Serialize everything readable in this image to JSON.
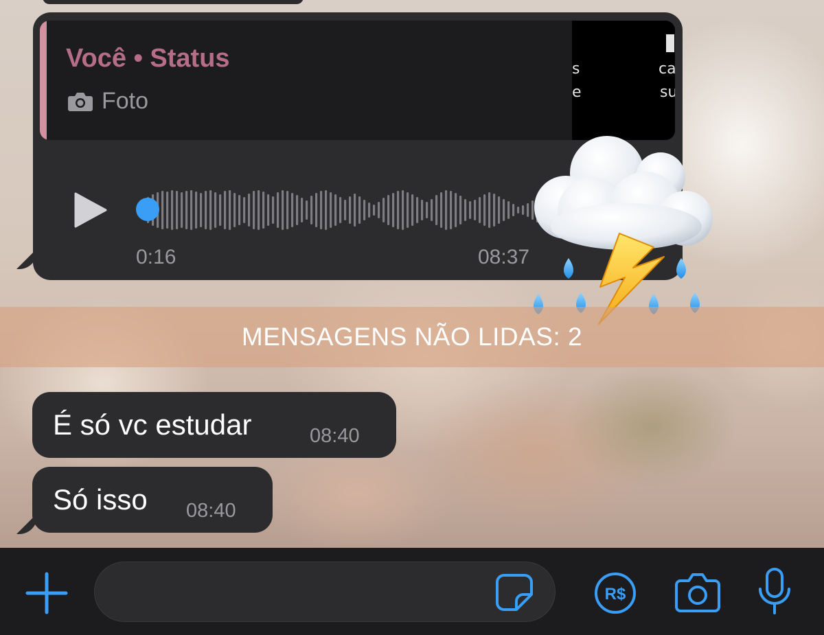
{
  "theme": {
    "accent": "#3a9ef7",
    "bubble": "#2c2c2e",
    "quote_author_color": "#b66e87",
    "quote_bar_color": "#d48fa0",
    "meta_text": "#9a9a9e",
    "input_bar": "#1c1c1e"
  },
  "audio_message": {
    "reply_quote": {
      "author": "Você • Status",
      "media_icon": "camera-icon",
      "media_type": "Foto",
      "thumbnail_fragments": [
        "s",
        "e",
        "ca",
        "su"
      ]
    },
    "play_icon": "play-icon",
    "progress": 0.0,
    "elapsed": "0:16",
    "time": "08:37"
  },
  "sticker": {
    "emoji": "cloud-with-lightning-and-rain",
    "icon": "storm-cloud-icon"
  },
  "unread_divider": {
    "label": "MENSAGENS NÃO LIDAS: 2"
  },
  "messages": [
    {
      "text": "É só vc estudar",
      "time": "08:40"
    },
    {
      "text": "Só isso",
      "time": "08:40"
    }
  ],
  "composer": {
    "placeholder": "",
    "buttons": {
      "attach": "plus-icon",
      "sticker": "sticker-icon",
      "payment": "payment-icon",
      "payment_label": "R$",
      "camera": "camera-icon",
      "microphone": "microphone-icon"
    }
  }
}
